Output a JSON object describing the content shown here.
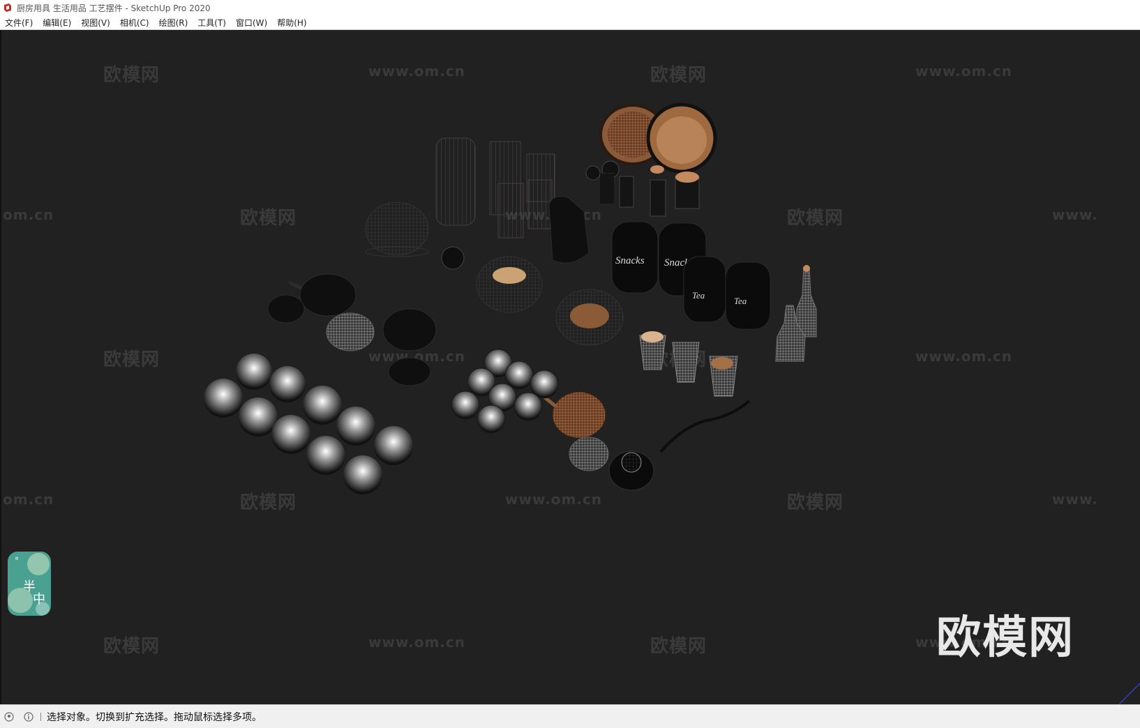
{
  "window": {
    "title": "厨房用具 生活用品 工艺摆件 - SketchUp Pro 2020",
    "app_icon": "sketchup-logo-icon"
  },
  "menu": {
    "items": [
      {
        "label": "文件(F)"
      },
      {
        "label": "编辑(E)"
      },
      {
        "label": "视图(V)"
      },
      {
        "label": "相机(C)"
      },
      {
        "label": "绘图(R)"
      },
      {
        "label": "工具(T)"
      },
      {
        "label": "窗口(W)"
      },
      {
        "label": "帮助(H)"
      }
    ]
  },
  "viewport": {
    "background": "#212121",
    "watermark_cn": "欧模网",
    "watermark_url": "www.om.cn",
    "watermark_url_partial": "om.cn",
    "watermark_url_cut": "www.",
    "big_watermark": "欧模网",
    "floating_logo": {
      "glyph_1": "半",
      "glyph_2": "中",
      "glyph_dot": "°"
    }
  },
  "status": {
    "icons": [
      "geolocation-icon",
      "info-icon"
    ],
    "text": "选择对象。切换到扩充选择。拖动鼠标选择多项。"
  },
  "colors": {
    "accent_logo": "#4aa091",
    "sketchup_red": "#c62828",
    "copper": "#b8734a"
  }
}
